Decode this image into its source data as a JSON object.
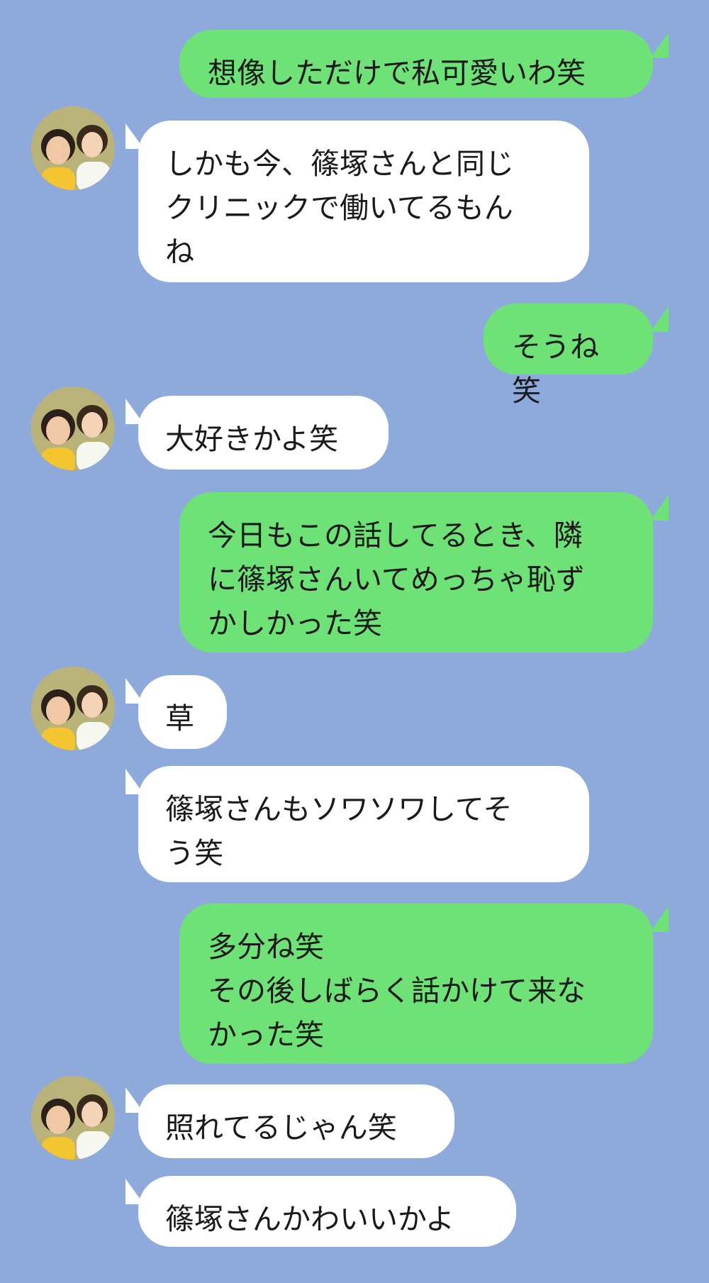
{
  "colors": {
    "background": "#8eaadb",
    "outgoing_bubble": "#6fe277",
    "incoming_bubble": "#ffffff",
    "text": "#1a1a1a"
  },
  "contact": {
    "avatar_icon": "avatar-photo-two-women"
  },
  "messages": [
    {
      "sender": "me",
      "text": "想像しただけで私可愛いわ笑"
    },
    {
      "sender": "contact",
      "text": "しかも今、篠塚さんと同じ\nクリニックで働いてるもん\nね"
    },
    {
      "sender": "me",
      "text": "そうね笑"
    },
    {
      "sender": "contact",
      "text": "大好きかよ笑"
    },
    {
      "sender": "me",
      "text": "今日もこの話してるとき、隣\nに篠塚さんいてめっちゃ恥ず\nかしかった笑"
    },
    {
      "sender": "contact",
      "text": "草"
    },
    {
      "sender": "contact",
      "text": "篠塚さんもソワソワしてそ\nう笑"
    },
    {
      "sender": "me",
      "text": "多分ね笑\nその後しばらく話かけて来な\nかった笑"
    },
    {
      "sender": "contact",
      "text": "照れてるじゃん笑"
    },
    {
      "sender": "contact",
      "text": "篠塚さんかわいいかよ"
    }
  ]
}
